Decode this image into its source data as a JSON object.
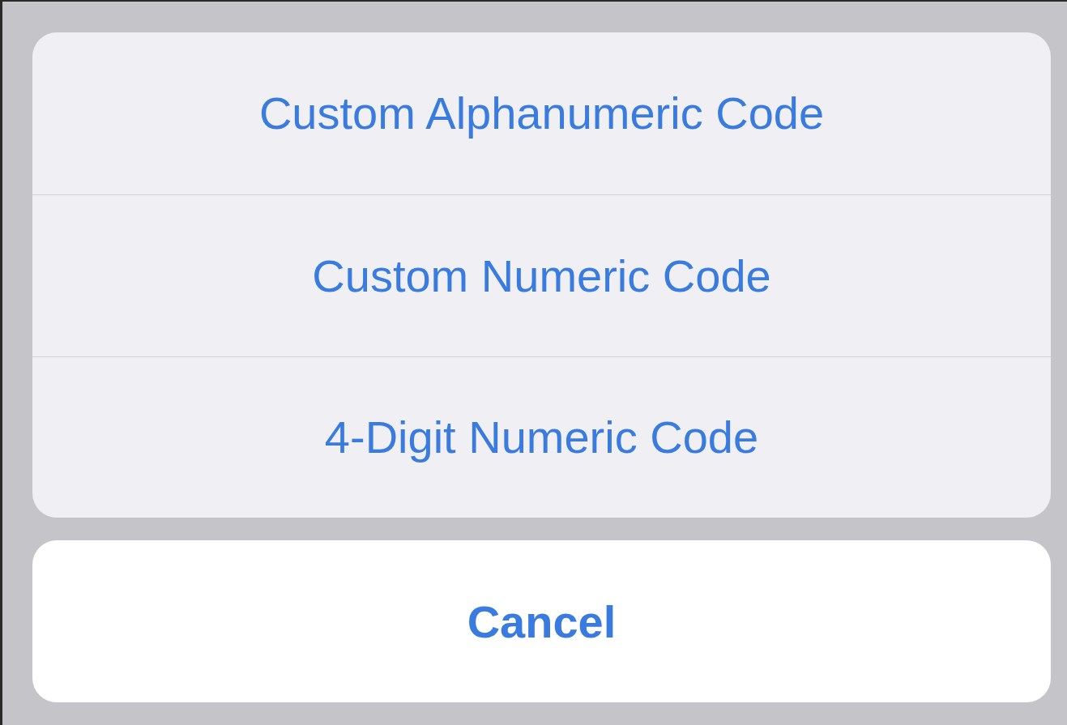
{
  "action_sheet": {
    "actions": [
      {
        "label": "Custom Alphanumeric Code"
      },
      {
        "label": "Custom Numeric Code"
      },
      {
        "label": "4-Digit Numeric Code"
      }
    ]
  },
  "cancel_button": {
    "label": "Cancel"
  }
}
